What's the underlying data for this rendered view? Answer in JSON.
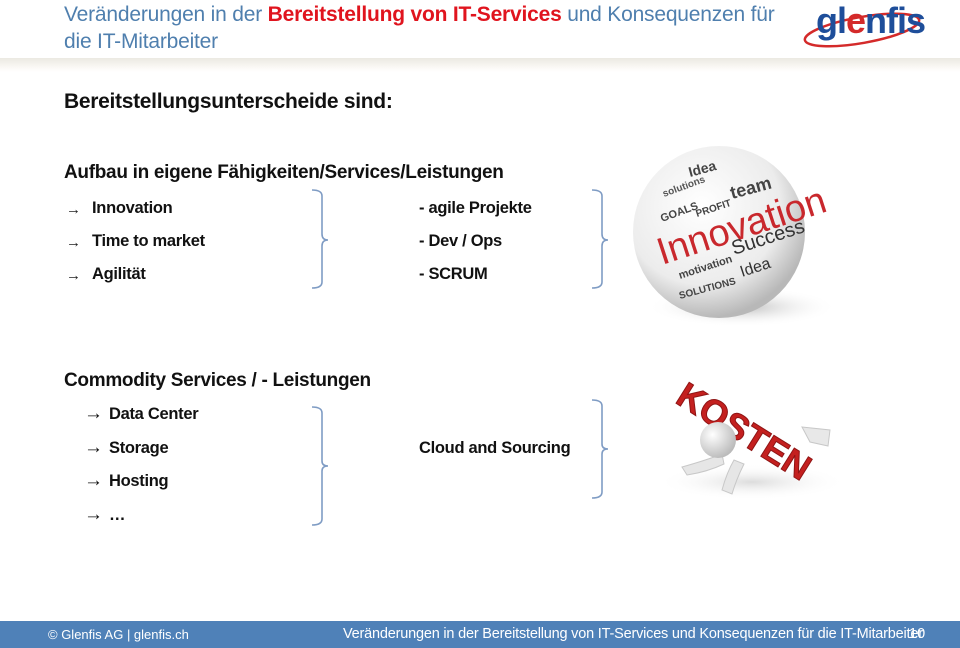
{
  "header": {
    "title_prefix": "Veränderungen in der ",
    "title_highlight": "Bereitstellung von IT-Services",
    "title_suffix": " und Konsequenzen für",
    "title_line2": "die IT-Mitarbeiter",
    "logo_text_g": "gl",
    "logo_text_e": "e",
    "logo_text_rest": "nfis"
  },
  "colors": {
    "title_blue": "#4f7fae",
    "title_red": "#e0141e",
    "footer_bg": "#4f81b8",
    "bracket": "#7f9cc4",
    "logo_blue": "#1e4e9a",
    "logo_red": "#d42a2a"
  },
  "content": {
    "heading": "Bereitstellungsunterscheide sind:",
    "section1": {
      "title": "Aufbau in eigene Fähigkeiten/Services/Leistungen",
      "arrow_icon": "→",
      "items": [
        "Innovation",
        "Time to market",
        "Agilität"
      ],
      "results": [
        "- agile Projekte",
        "- Dev / Ops",
        "- SCRUM"
      ],
      "image": "innovation-word-sphere"
    },
    "section2": {
      "title": "Commodity Services / - Leistungen",
      "arrow_icon": "→",
      "items": [
        "Data Center",
        "Storage",
        "Hosting",
        "…"
      ],
      "result": "Cloud and Sourcing",
      "image": "kosten-figure"
    }
  },
  "sphere_words": {
    "main": "Innovation",
    "w1": "Success",
    "w2": "Idea",
    "w3": "team",
    "w4": "GOALS",
    "w5": "PROFIT",
    "w6": "solutions",
    "w7": "motivation",
    "w8": "SOLUTIONS",
    "w9": "Idea"
  },
  "kosten_word": "KOSTEN",
  "footer": {
    "copyright": "© Glenfis AG | glenfis.ch",
    "title": "Veränderungen in der Bereitstellung von IT-Services und Konsequenzen für die IT-Mitarbeiter",
    "page": "10"
  }
}
